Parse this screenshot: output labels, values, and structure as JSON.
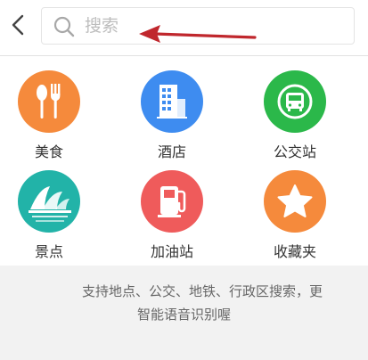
{
  "search": {
    "placeholder": "搜索"
  },
  "categories": [
    {
      "label": "美食",
      "icon": "fork-knife-icon",
      "color": "#f58a3c"
    },
    {
      "label": "酒店",
      "icon": "building-icon",
      "color": "#3e8cf0"
    },
    {
      "label": "公交站",
      "icon": "bus-icon",
      "color": "#2bb84a"
    },
    {
      "label": "景点",
      "icon": "sydney-opera-house-icon",
      "color": "#22b3a8"
    },
    {
      "label": "加油站",
      "icon": "gas-pump-icon",
      "color": "#ef5b5b"
    },
    {
      "label": "收藏夹",
      "icon": "star-icon",
      "color": "#f58a3c"
    }
  ],
  "hint": {
    "line1": "支持地点、公交、地铁、行政区搜索，更",
    "line2": "智能语音识别喔"
  },
  "colors": {
    "annotation_arrow": "#c0272d",
    "background": "#f2f2f2",
    "panel": "#ffffff"
  }
}
